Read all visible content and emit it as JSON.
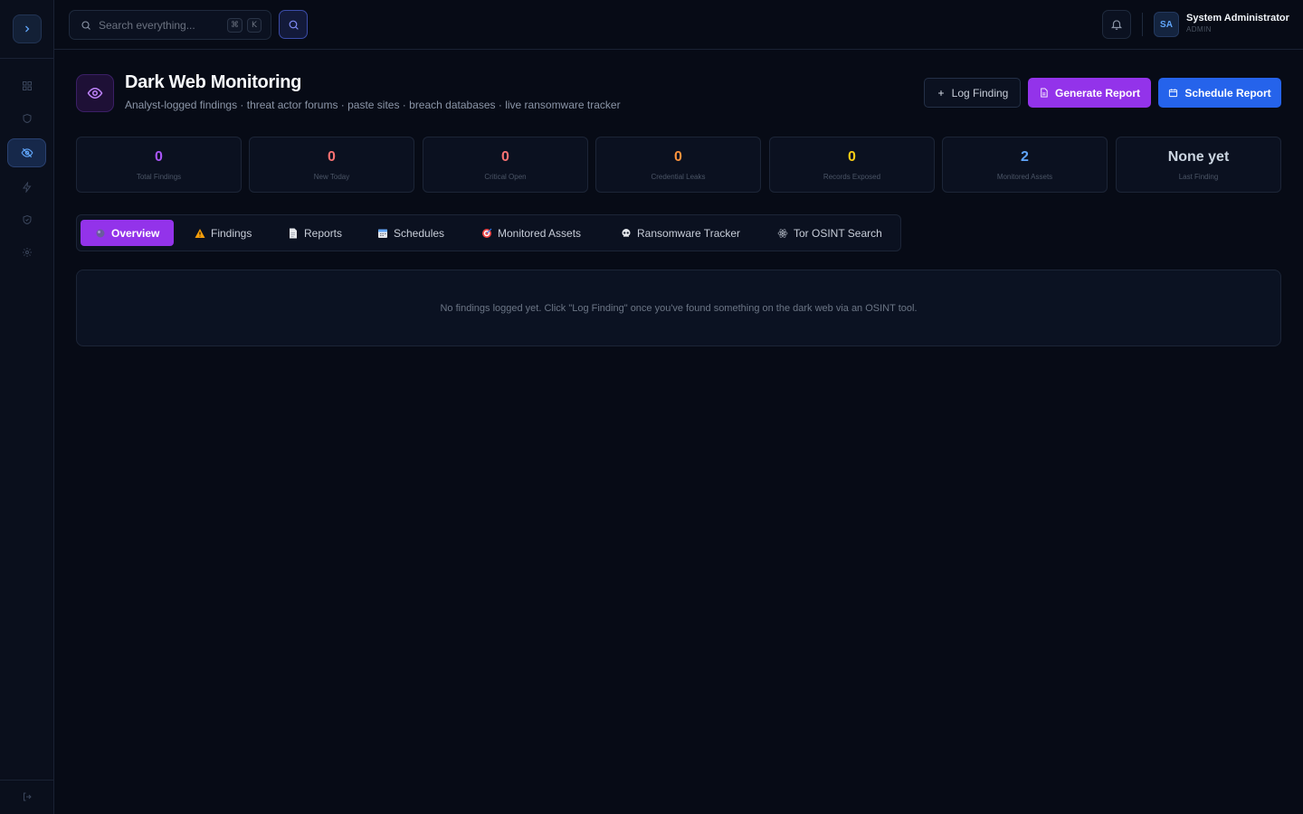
{
  "search": {
    "placeholder": "Search everything...",
    "kbd_cmd": "⌘",
    "kbd_key": "K"
  },
  "user": {
    "initials": "SA",
    "name": "System Administrator",
    "role": "ADMIN"
  },
  "page": {
    "title": "Dark Web Monitoring",
    "subtitle": "Analyst-logged findings · threat actor forums · paste sites · breach databases · live ransomware tracker"
  },
  "actions": {
    "log_finding": "Log Finding",
    "generate_report": "Generate Report",
    "schedule_report": "Schedule Report"
  },
  "stats": [
    {
      "value": "0",
      "label": "Total Findings",
      "color": "#a855f7"
    },
    {
      "value": "0",
      "label": "New Today",
      "color": "#f87171"
    },
    {
      "value": "0",
      "label": "Critical Open",
      "color": "#f87171"
    },
    {
      "value": "0",
      "label": "Credential Leaks",
      "color": "#fb923c"
    },
    {
      "value": "0",
      "label": "Records Exposed",
      "color": "#facc15"
    },
    {
      "value": "2",
      "label": "Monitored Assets",
      "color": "#60a5fa"
    },
    {
      "value": "None yet",
      "label": "Last Finding",
      "color": "#cbd5e1"
    }
  ],
  "tabs": [
    {
      "label": "Overview",
      "icon": "globe-icon",
      "active": true
    },
    {
      "label": "Findings",
      "icon": "warning-icon",
      "active": false
    },
    {
      "label": "Reports",
      "icon": "document-icon",
      "active": false
    },
    {
      "label": "Schedules",
      "icon": "calendar-icon",
      "active": false
    },
    {
      "label": "Monitored Assets",
      "icon": "target-icon",
      "active": false
    },
    {
      "label": "Ransomware Tracker",
      "icon": "skull-icon",
      "active": false
    },
    {
      "label": "Tor OSINT Search",
      "icon": "atom-icon",
      "active": false
    }
  ],
  "empty_state": "No findings logged yet. Click \"Log Finding\" once you've found something on the dark web via an OSINT tool.",
  "colors": {
    "purple": "#9333ea",
    "blue": "#2563eb",
    "background": "#070b16"
  }
}
